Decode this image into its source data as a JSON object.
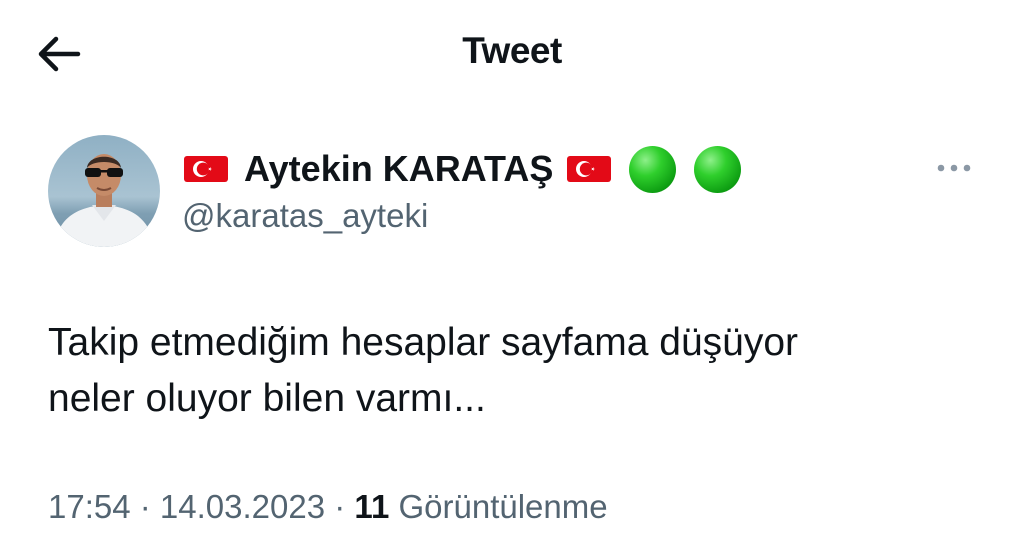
{
  "header": {
    "title": "Tweet",
    "back_icon": "arrow-left-icon"
  },
  "author": {
    "name": "Aytekin KARATAŞ",
    "handle": "@karatas_ayteki",
    "emoji_icons": [
      "turkish-flag-icon",
      "turkish-flag-icon",
      "green-circle-icon",
      "green-circle-icon"
    ]
  },
  "tweet": {
    "lines": [
      "Takip etmediğim hesaplar sayfama düşüyor",
      "neler oluyor bilen varmı..."
    ]
  },
  "meta": {
    "time": "17:54",
    "separator": " · ",
    "date": "14.03.2023",
    "views_count": "11",
    "views_label": "Görüntülenme"
  },
  "colors": {
    "text": "#0f1419",
    "secondary": "#536471",
    "flag_red": "#e30a17",
    "green": "#2fcf2c"
  }
}
